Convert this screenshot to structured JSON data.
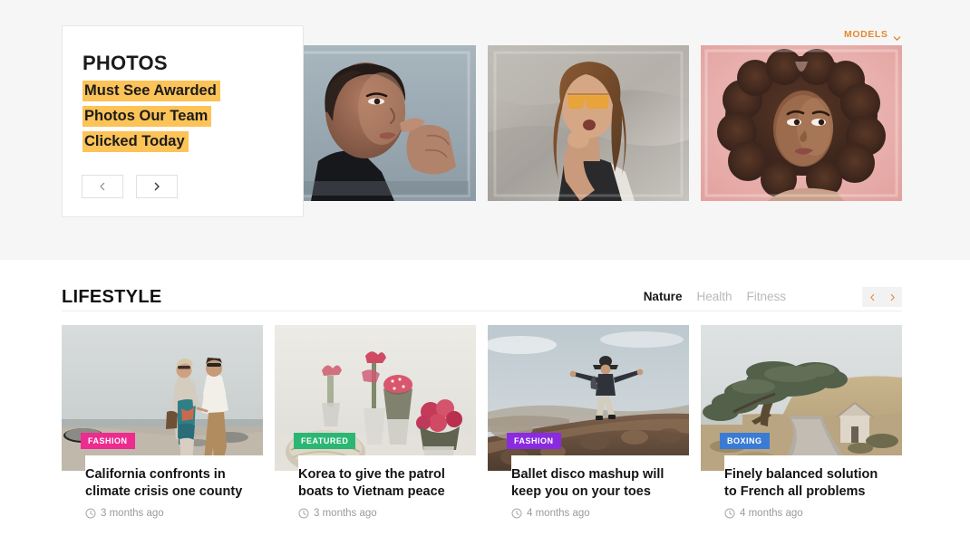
{
  "theme": {
    "page_bg": "#ffffff",
    "top_section_bg": "#f7f6f6",
    "accent_orange": "#e08a2e",
    "highlight_yellow": "#fbc358",
    "muted_text": "#9b9b9b"
  },
  "top_bar": {
    "models_label": "MODELS",
    "models_icon": "chevron-down-icon"
  },
  "photos_panel": {
    "kicker": "PHOTOS",
    "headline_lines": [
      "Must See Awarded",
      "Photos Our Team",
      "Clicked Today"
    ],
    "prev_icon": "chevron-left-icon",
    "next_icon": "chevron-right-icon"
  },
  "photo_thumbs": [
    {
      "alt": "Woman in black turtleneck touching her lip against a blue-gray studio backdrop",
      "bg": "#9aa9b2"
    },
    {
      "alt": "Woman with orange sunglasses and long hair in front of a gray marble wall",
      "bg": "#b8b2ac"
    },
    {
      "alt": "Woman with voluminous curly hair on a pink studio backdrop",
      "bg": "#eab4b2"
    }
  ],
  "lifestyle": {
    "title": "LIFESTYLE",
    "tabs": [
      {
        "label": "Nature",
        "active": true
      },
      {
        "label": "Health",
        "active": false
      },
      {
        "label": "Fitness",
        "active": false
      }
    ],
    "prev_icon": "chevron-left-icon",
    "next_icon": "chevron-right-icon",
    "cards": [
      {
        "badge": "FASHION",
        "badge_color": "#ec2c8f",
        "title": "California confronts in climate crisis one county",
        "time": "3 months ago",
        "time_icon": "clock-icon",
        "image_alt": "Couple walking hand in hand along a rocky beach at dusk"
      },
      {
        "badge": "FEATURED",
        "badge_color": "#2bb673",
        "title": "Korea to give the patrol boats to Vietnam peace",
        "time": "3 months ago",
        "time_icon": "clock-icon",
        "image_alt": "Pink flowers in small glass vases on a white table"
      },
      {
        "badge": "FASHION",
        "badge_color": "#8a2be2",
        "title": "Ballet disco mashup will keep you on your toes",
        "time": "4 months ago",
        "time_icon": "clock-icon",
        "image_alt": "Person balancing with arms out on a rocky wall under a pale sky"
      },
      {
        "badge": "BOXING",
        "badge_color": "#3a7bd5",
        "title": "Finely balanced solution to French all problems",
        "time": "4 months ago",
        "time_icon": "clock-icon",
        "image_alt": "Windswept cypress tree beside a dirt road and small white house on a hill"
      }
    ]
  }
}
